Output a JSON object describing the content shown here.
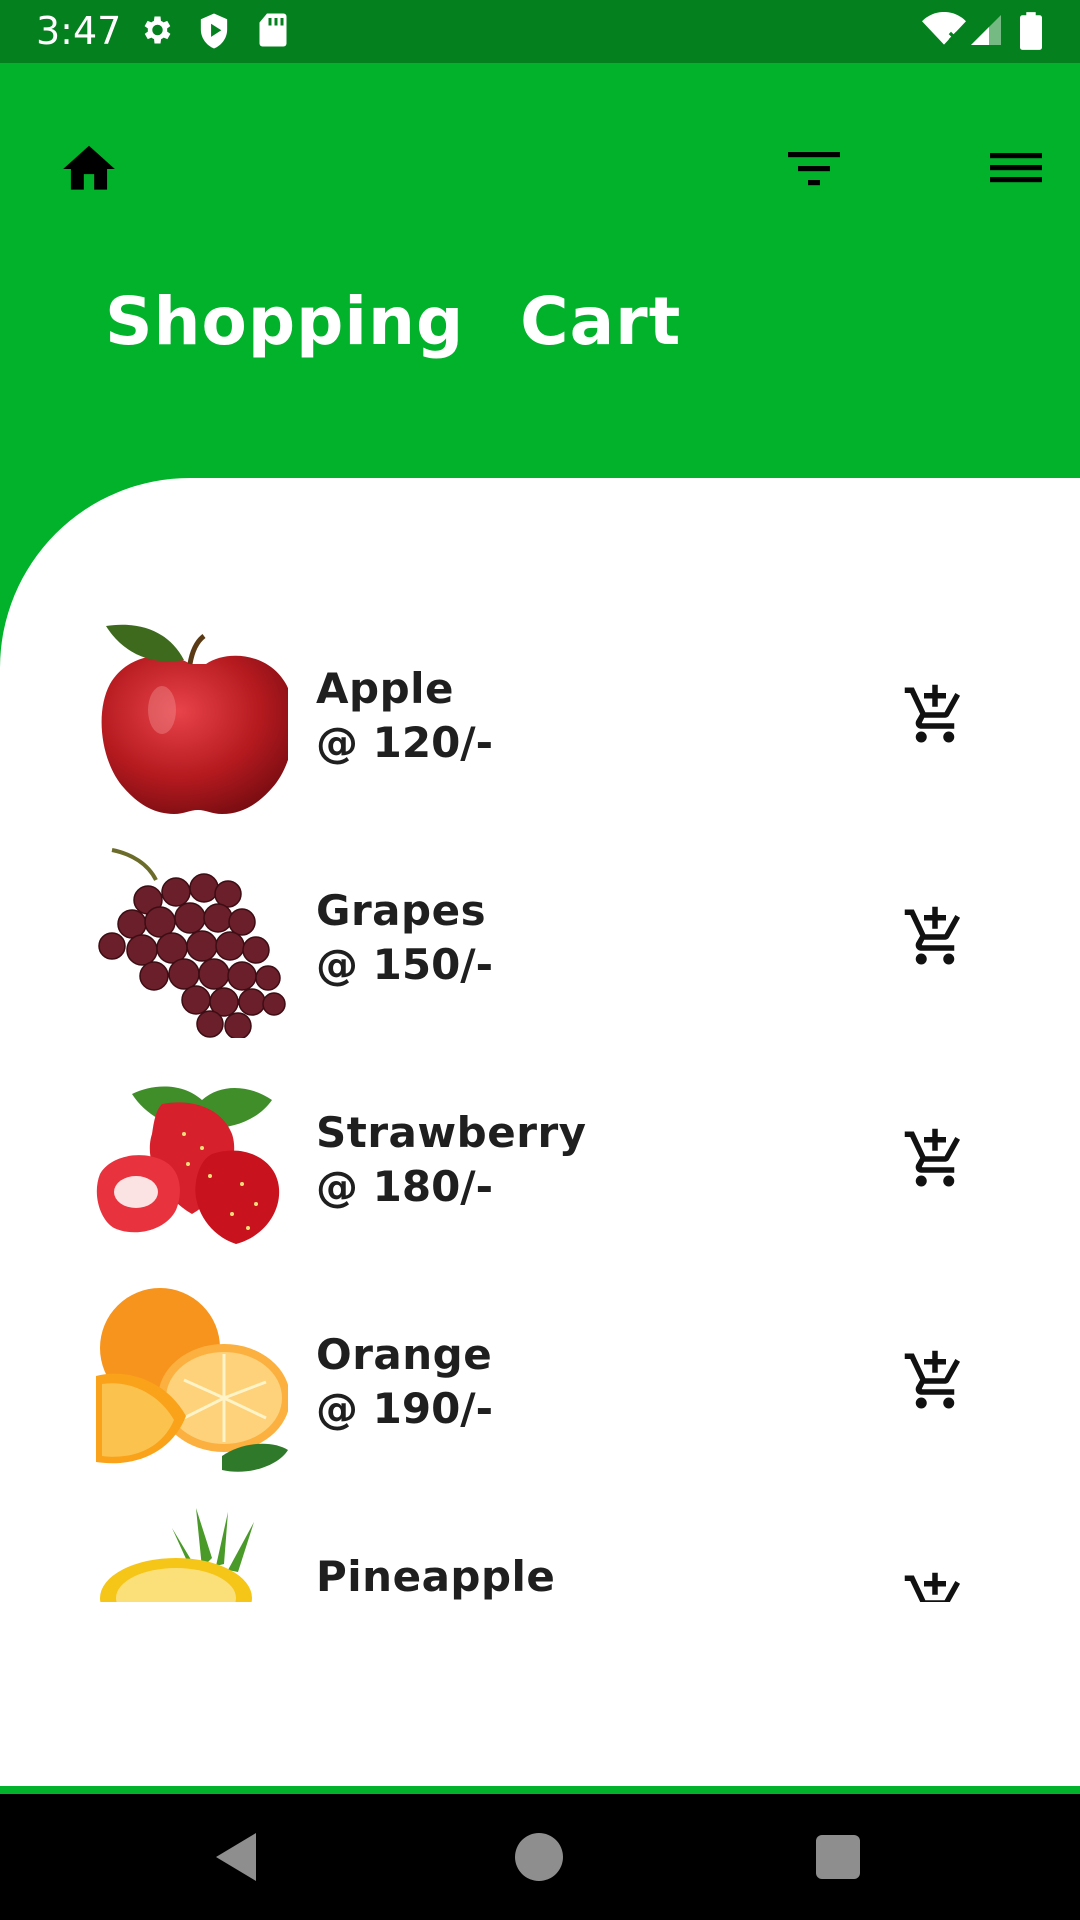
{
  "status_bar": {
    "time": "3:47"
  },
  "header": {
    "title": "Shopping Cart"
  },
  "products": [
    {
      "name": "Apple",
      "price": "@ 120/-"
    },
    {
      "name": "Grapes",
      "price": "@ 150/-"
    },
    {
      "name": "Strawberry",
      "price": "@ 180/-"
    },
    {
      "name": "Orange",
      "price": "@ 190/-"
    },
    {
      "name": "Pineapple",
      "price": ""
    }
  ],
  "colors": {
    "primary": "#02b22a",
    "status_bar": "#04801e",
    "text": "#1f1f1f"
  },
  "icons": {
    "home": "home-icon",
    "filter": "filter-icon",
    "menu": "hamburger-menu-icon",
    "add_to_cart": "add-shopping-cart-icon"
  }
}
